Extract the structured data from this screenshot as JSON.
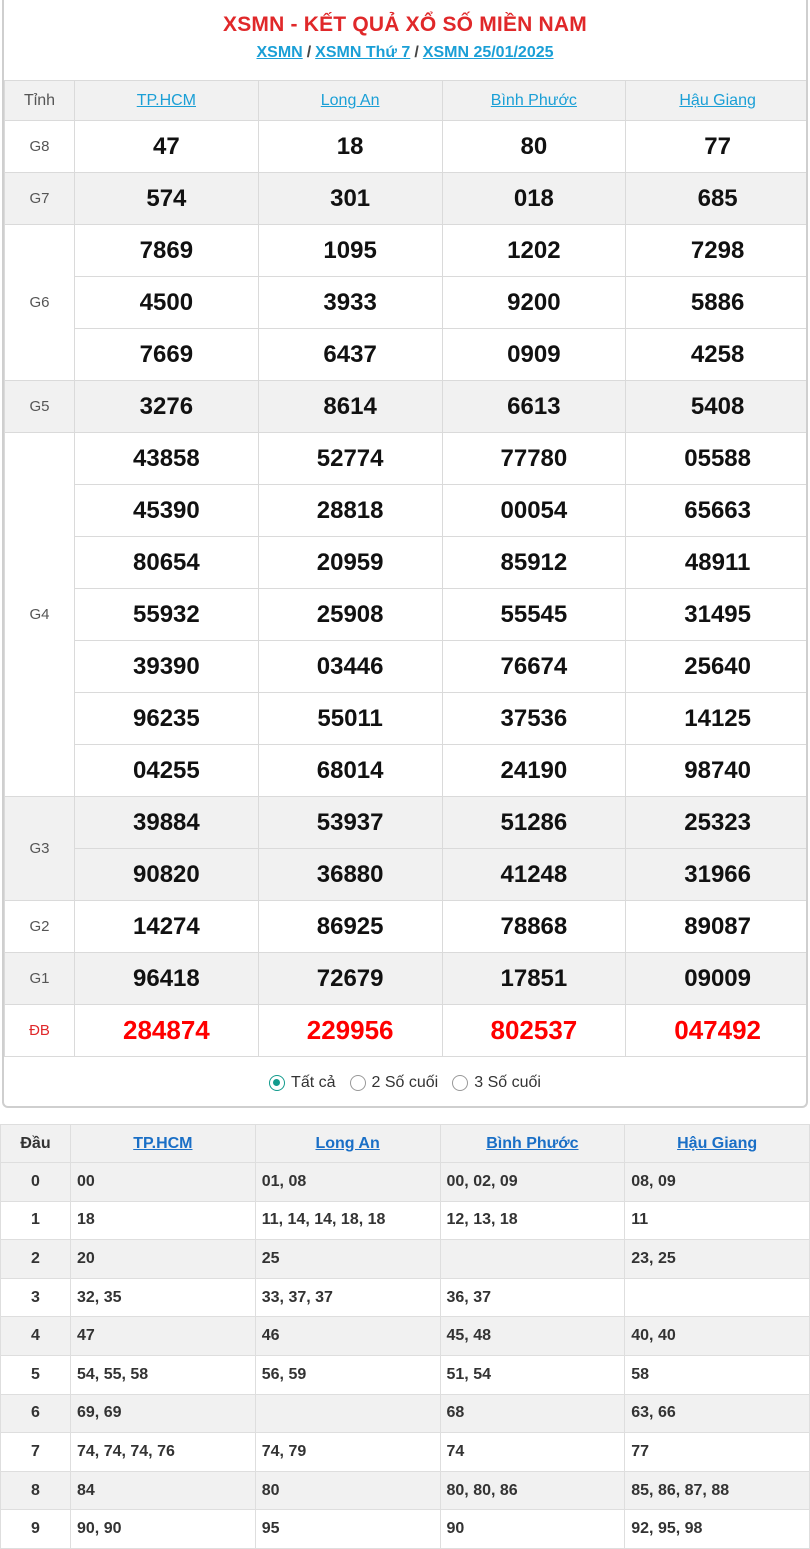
{
  "header": {
    "title": "XSMN - KẾT QUẢ XỔ SỐ MIỀN NAM",
    "breadcrumb": [
      "XSMN",
      "XSMN Thứ 7",
      "XSMN 25/01/2025"
    ],
    "separator": "/"
  },
  "results": {
    "col_label": "Tỉnh",
    "provinces": [
      "TP.HCM",
      "Long An",
      "Bình Phước",
      "Hậu Giang"
    ],
    "prizes": [
      {
        "label": "G8",
        "rows": [
          [
            "47",
            "18",
            "80",
            "77"
          ]
        ]
      },
      {
        "label": "G7",
        "rows": [
          [
            "574",
            "301",
            "018",
            "685"
          ]
        ]
      },
      {
        "label": "G6",
        "rows": [
          [
            "7869",
            "1095",
            "1202",
            "7298"
          ],
          [
            "4500",
            "3933",
            "9200",
            "5886"
          ],
          [
            "7669",
            "6437",
            "0909",
            "4258"
          ]
        ]
      },
      {
        "label": "G5",
        "rows": [
          [
            "3276",
            "8614",
            "6613",
            "5408"
          ]
        ]
      },
      {
        "label": "G4",
        "rows": [
          [
            "43858",
            "52774",
            "77780",
            "05588"
          ],
          [
            "45390",
            "28818",
            "00054",
            "65663"
          ],
          [
            "80654",
            "20959",
            "85912",
            "48911"
          ],
          [
            "55932",
            "25908",
            "55545",
            "31495"
          ],
          [
            "39390",
            "03446",
            "76674",
            "25640"
          ],
          [
            "96235",
            "55011",
            "37536",
            "14125"
          ],
          [
            "04255",
            "68014",
            "24190",
            "98740"
          ]
        ]
      },
      {
        "label": "G3",
        "rows": [
          [
            "39884",
            "53937",
            "51286",
            "25323"
          ],
          [
            "90820",
            "36880",
            "41248",
            "31966"
          ]
        ]
      },
      {
        "label": "G2",
        "rows": [
          [
            "14274",
            "86925",
            "78868",
            "89087"
          ]
        ]
      },
      {
        "label": "G1",
        "rows": [
          [
            "96418",
            "72679",
            "17851",
            "09009"
          ]
        ]
      },
      {
        "label": "ĐB",
        "rows": [
          [
            "284874",
            "229956",
            "802537",
            "047492"
          ]
        ]
      }
    ]
  },
  "filter": {
    "options": [
      "Tất cả",
      "2 Số cuối",
      "3 Số cuối"
    ],
    "selected": "Tất cả"
  },
  "loto": {
    "col_label": "Đầu",
    "provinces": [
      "TP.HCM",
      "Long An",
      "Bình Phước",
      "Hậu Giang"
    ],
    "rows": [
      {
        "head": "0",
        "values": [
          "00",
          "01, 08",
          "00, 02, 09",
          "08, 09"
        ]
      },
      {
        "head": "1",
        "values": [
          "18",
          "11, 14, 14, 18, 18",
          "12, 13, 18",
          "11"
        ]
      },
      {
        "head": "2",
        "values": [
          "20",
          "25",
          "",
          "23, 25"
        ]
      },
      {
        "head": "3",
        "values": [
          "32, 35",
          "33, 37, 37",
          "36, 37",
          ""
        ]
      },
      {
        "head": "4",
        "values": [
          "47",
          "46",
          "45, 48",
          "40, 40"
        ]
      },
      {
        "head": "5",
        "values": [
          "54, 55, 58",
          "56, 59",
          "51, 54",
          "58"
        ]
      },
      {
        "head": "6",
        "values": [
          "69, 69",
          "",
          "68",
          "63, 66"
        ]
      },
      {
        "head": "7",
        "values": [
          "74, 74, 74, 76",
          "74, 79",
          "74",
          "77"
        ]
      },
      {
        "head": "8",
        "values": [
          "84",
          "80",
          "80, 80, 86",
          "85, 86, 87, 88"
        ]
      },
      {
        "head": "9",
        "values": [
          "90, 90",
          "95",
          "90",
          "92, 95, 98"
        ]
      }
    ]
  },
  "colors": {
    "accent_red": "#e0282a",
    "link_blue": "#1a9fd6",
    "special_prize": "#ff0000",
    "radio_on": "#139b8d"
  }
}
